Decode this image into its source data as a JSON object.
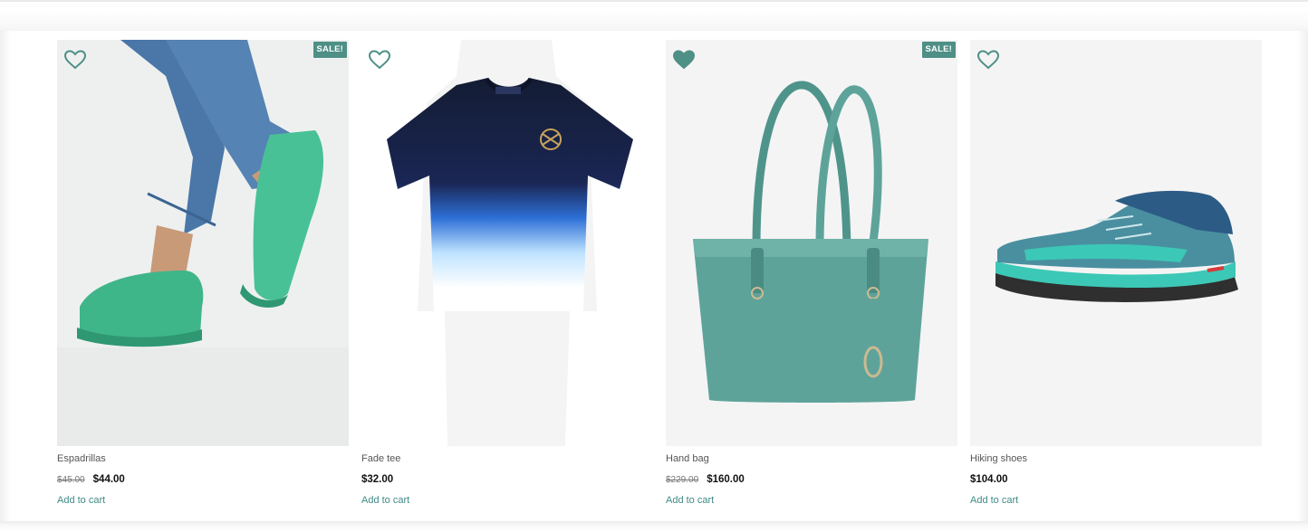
{
  "products": [
    {
      "name": "Espadrillas",
      "old_price": "$45.00",
      "price": "$44.00",
      "sale_badge": "SALE!",
      "cart_label": "Add to cart",
      "favorited": false,
      "image_icon": "espadrilles-photo"
    },
    {
      "name": "Fade tee",
      "price": "$32.00",
      "cart_label": "Add to cart",
      "favorited": false,
      "image_icon": "tshirt-photo"
    },
    {
      "name": "Hand bag",
      "old_price": "$229.00",
      "price": "$160.00",
      "sale_badge": "SALE!",
      "cart_label": "Add to cart",
      "favorited": true,
      "image_icon": "handbag-photo"
    },
    {
      "name": "Hiking shoes",
      "price": "$104.00",
      "cart_label": "Add to cart",
      "favorited": false,
      "image_icon": "hiking-shoe-photo"
    }
  ],
  "colors": {
    "accent": "#3f8a86",
    "sale_badge": "#4e8f86",
    "heart": "#4e8f86"
  }
}
